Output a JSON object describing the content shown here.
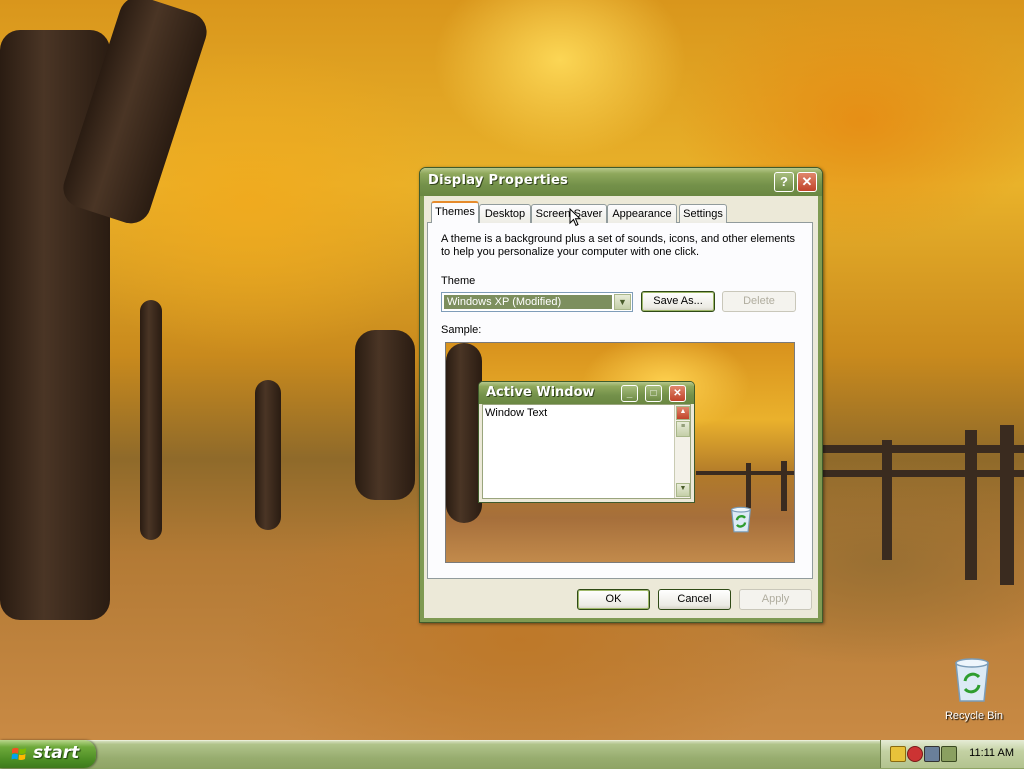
{
  "window": {
    "title": "Display Properties",
    "help_btn": "?",
    "close_btn": "✕"
  },
  "tabs": [
    {
      "label": "Themes",
      "active": true
    },
    {
      "label": "Desktop",
      "active": false
    },
    {
      "label": "Screen Saver",
      "active": false
    },
    {
      "label": "Appearance",
      "active": false
    },
    {
      "label": "Settings",
      "active": false
    }
  ],
  "themes": {
    "description_line1": "A theme is a background plus a set of sounds, icons, and other elements",
    "description_line2": "to help you personalize your computer with one click.",
    "theme_label": "Theme",
    "theme_value": "Windows XP (Modified)",
    "save_as_label": "Save As...",
    "delete_label": "Delete",
    "sample_label": "Sample:"
  },
  "sample": {
    "window_title": "Active Window",
    "window_text": "Window Text"
  },
  "dialog_buttons": {
    "ok": "OK",
    "cancel": "Cancel",
    "apply": "Apply"
  },
  "desktop": {
    "recycle_bin_label": "Recycle Bin"
  },
  "taskbar": {
    "start_label": "start",
    "clock": "11:11 AM"
  },
  "colors": {
    "titlebar": "#74914a",
    "tab_highlight": "#e68b2c",
    "taskbar": "#98ad6f",
    "start_button": "#4a8b22"
  }
}
